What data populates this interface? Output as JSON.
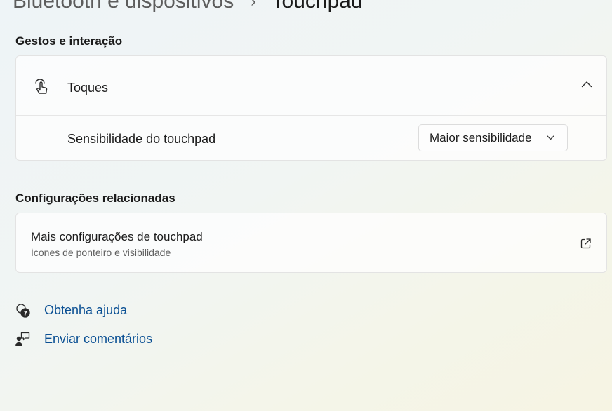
{
  "breadcrumb": {
    "parent": "Bluetooth e dispositivos",
    "separator": "›",
    "current": "Touchpad"
  },
  "gestures": {
    "section_title": "Gestos e interação",
    "taps": {
      "icon": "tap-hand-icon",
      "label": "Toques",
      "expanded": true,
      "sensitivity_label": "Sensibilidade do touchpad",
      "sensitivity_value": "Maior sensibilidade"
    }
  },
  "related": {
    "section_title": "Configurações relacionadas",
    "more": {
      "title": "Mais configurações de touchpad",
      "subtitle": "Ícones de ponteiro e visibilidade",
      "icon": "open-external-icon"
    }
  },
  "help": {
    "get_help": "Obtenha ajuda",
    "feedback": "Enviar comentários"
  },
  "colors": {
    "link": "#0a4f93",
    "text": "#1b1b1b"
  }
}
